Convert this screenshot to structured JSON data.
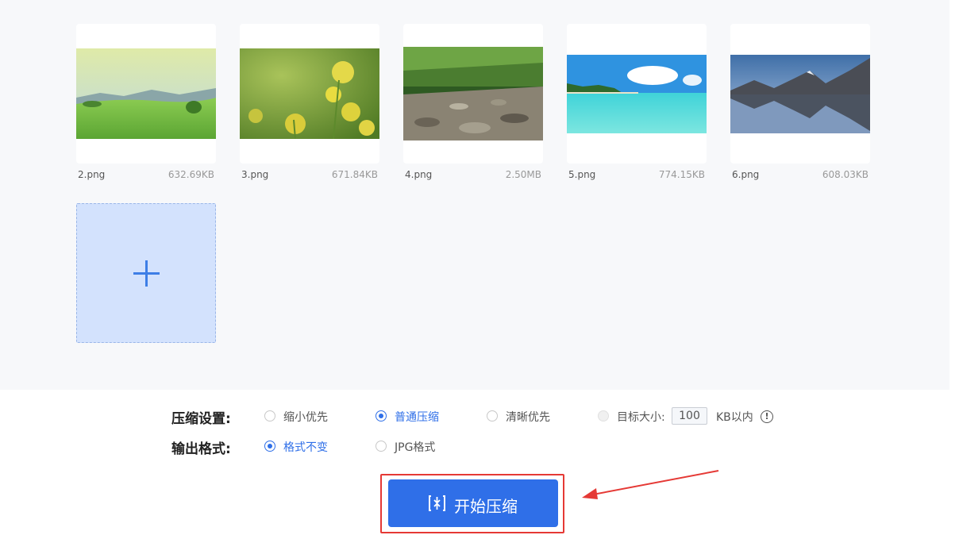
{
  "images": [
    {
      "name": "2.png",
      "size": "632.69KB"
    },
    {
      "name": "3.png",
      "size": "671.84KB"
    },
    {
      "name": "4.png",
      "size": "2.50MB"
    },
    {
      "name": "5.png",
      "size": "774.15KB"
    },
    {
      "name": "6.png",
      "size": "608.03KB"
    }
  ],
  "settings": {
    "compress_label": "压缩设置:",
    "compress_options": [
      "缩小优先",
      "普通压缩",
      "清晰优先",
      "目标大小:"
    ],
    "compress_selected": "普通压缩",
    "target_size_value": "100",
    "target_unit": "KB以内",
    "output_label": "输出格式:",
    "output_options": [
      "格式不变",
      "JPG格式"
    ],
    "output_selected": "格式不变"
  },
  "start_button": {
    "label": "开始压缩"
  },
  "colors": {
    "accent": "#2f6fe8",
    "highlight": "#e53935",
    "add_tile": "#d3e2fd"
  }
}
